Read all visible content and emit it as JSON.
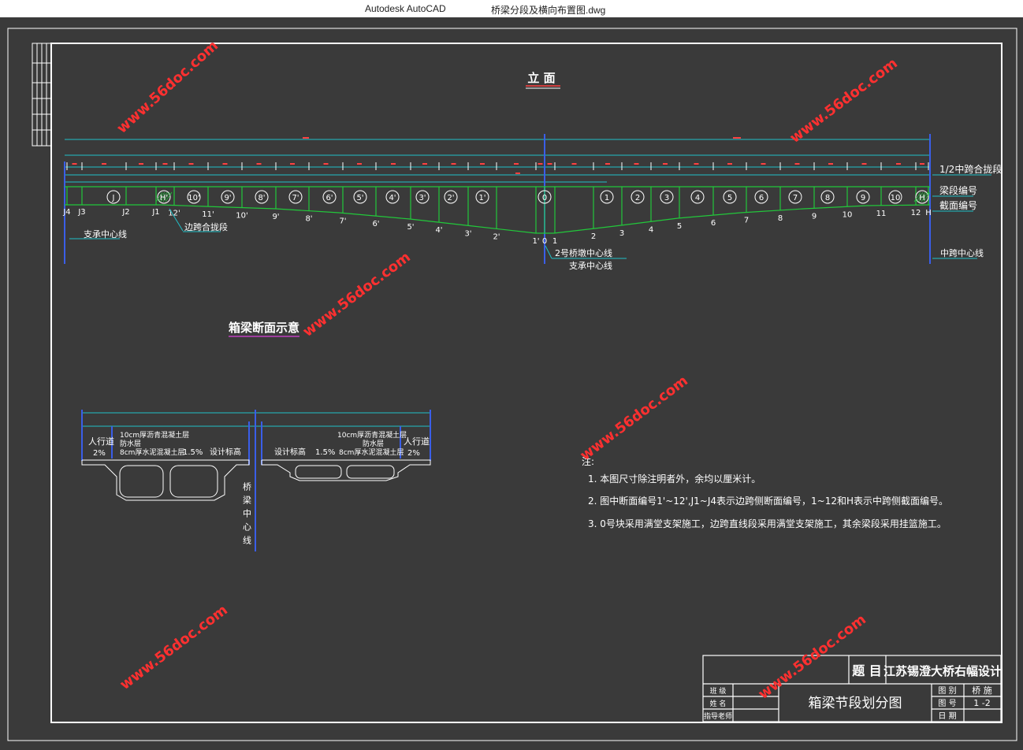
{
  "window": {
    "app_name": "Autodesk AutoCAD",
    "file_name": "桥梁分段及横向布置图.dwg"
  },
  "drawing": {
    "elevation_title": "立 面",
    "section_title": "箱梁断面示意",
    "top_labels": {
      "half_closure": "1/2中跨合拢段",
      "segment_no": "梁段编号",
      "section_no": "截面编号"
    },
    "side_span_closure": "边跨合拢段",
    "bearing_centerline_left": "支承中心线",
    "pier2_centerline": "2号桥墩中心线",
    "bearing_centerline_mid": "支承中心线",
    "midspan_centerline": "中跨中心线",
    "section_nodes_left": [
      "J4",
      "J3",
      "J2",
      "J1",
      "12'",
      "11'",
      "10'",
      "9'",
      "8'",
      "7'",
      "6'",
      "5'",
      "4'",
      "3'",
      "2'",
      "1'",
      "0",
      "1",
      "2",
      "3",
      "4",
      "5",
      "6",
      "7",
      "8",
      "9",
      "10",
      "11",
      "12",
      "H"
    ],
    "segment_circles_left": [
      "J",
      "H'",
      "10'",
      "9'",
      "8'",
      "7'",
      "6'",
      "5'",
      "4'",
      "3'",
      "2'",
      "1'"
    ],
    "segment_circle_center": "0",
    "segment_circles_right": [
      "1",
      "2",
      "3",
      "4",
      "5",
      "6",
      "7",
      "8",
      "9",
      "10",
      "H"
    ],
    "cross_section": {
      "sidewalk_left": "人行道",
      "slope_left": "2%",
      "layers_left": [
        "10cm厚沥青混凝土层",
        "防水层",
        "8cm厚水泥混凝土层"
      ],
      "cross_slope_left": "1.5%",
      "design_elev_left": "设计标高",
      "design_elev_right": "设计标高",
      "cross_slope_right": "1.5%",
      "layers_right": [
        "10cm厚沥青混凝土层",
        "防水层",
        "8cm厚水泥混凝土层"
      ],
      "sidewalk_right": "人行道",
      "slope_right": "2%",
      "bridge_centerline_vertical": "桥梁中心线"
    },
    "notes": {
      "heading": "注:",
      "items": [
        "1. 本图尺寸除注明者外，余均以厘米计。",
        "2. 图中断面编号1'~12',J1~J4表示边跨侧断面编号，1~12和H表示中跨侧截面编号。",
        "3. 0号块采用满堂支架施工，边跨直线段采用满堂支架施工，其余梁段采用挂篮施工。"
      ]
    },
    "title_block": {
      "topic_label": "题 目",
      "project_title": "江苏锡澄大桥右幅设计",
      "drawing_name": "箱梁节段划分图",
      "row_labels": [
        "班 级",
        "姓 名",
        "指导老师"
      ],
      "right_labels": [
        "图 别",
        "图 号",
        "日 期"
      ],
      "right_values": [
        "桥 施",
        "1 -2",
        ""
      ]
    },
    "watermark": "www.56doc.com"
  },
  "colors": {
    "green": "#22c83a",
    "cyan": "#20c0c8",
    "blue": "#3a5ee8",
    "red": "#ff4040",
    "white": "#ffffff",
    "background": "#3a3a3a"
  }
}
